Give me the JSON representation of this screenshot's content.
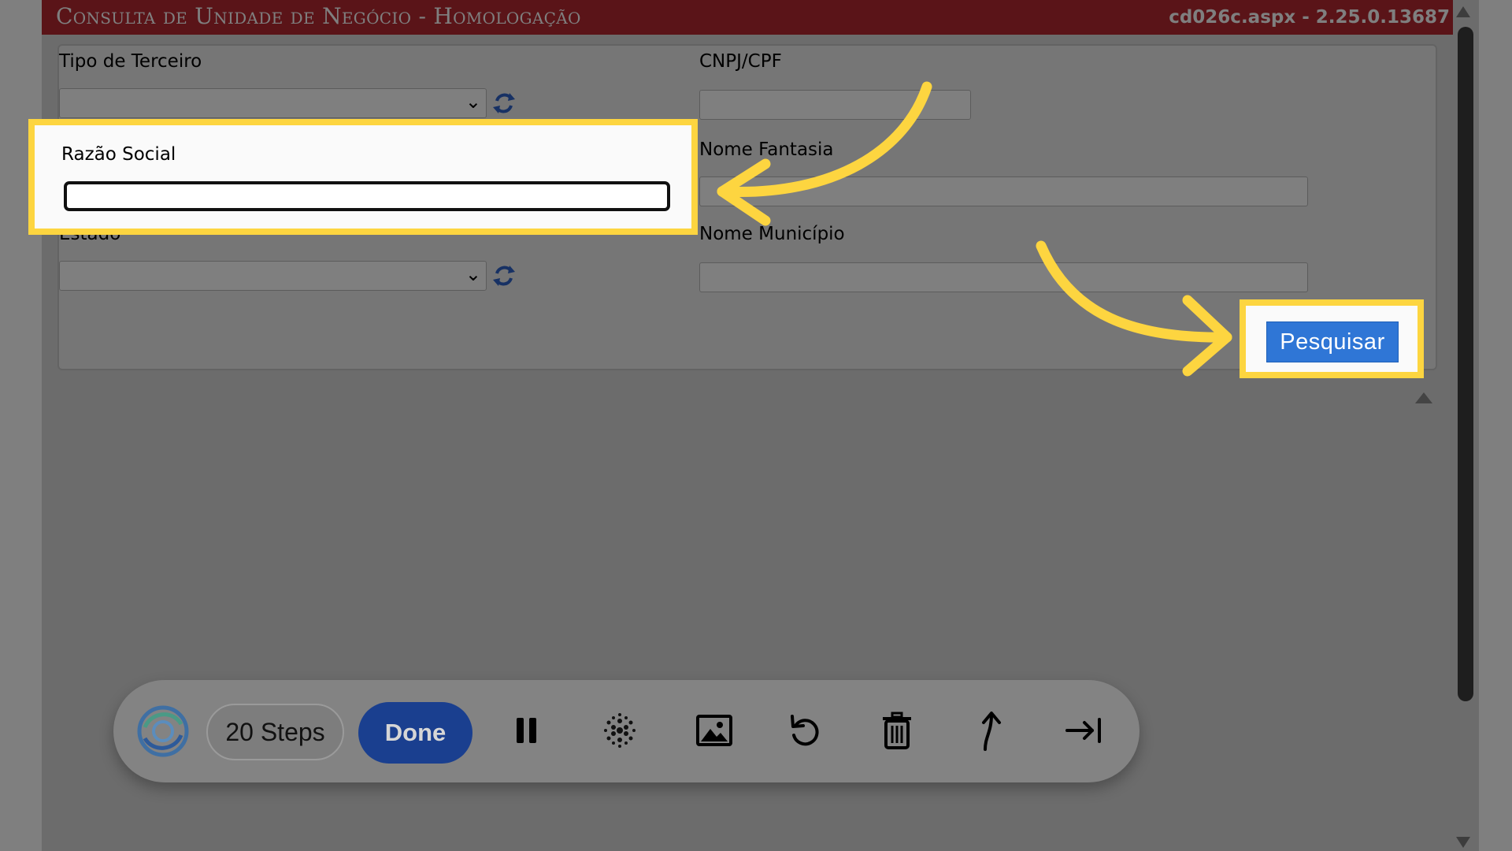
{
  "window": {
    "title": "Consulta de Unidade de Negócio  - Homologação",
    "version": "cd026c.aspx - 2.25.0.13687"
  },
  "form": {
    "tipo_terceiro": {
      "label": "Tipo de Terceiro",
      "value": ""
    },
    "cnpj_cpf": {
      "label": "CNPJ/CPF",
      "value": ""
    },
    "razao_social": {
      "label": "Razão Social",
      "value": ""
    },
    "nome_fantasia": {
      "label": "Nome Fantasia",
      "value": ""
    },
    "estado": {
      "label": "Estado",
      "value": ""
    },
    "nome_municipio": {
      "label": "Nome Município",
      "value": ""
    },
    "search_button": "Pesquisar"
  },
  "toolbar": {
    "steps_label": "20 Steps",
    "done_label": "Done",
    "icons": [
      "logo-icon",
      "pause-icon",
      "blur-icon",
      "image-icon",
      "undo-icon",
      "delete-icon",
      "upload-icon",
      "skip-icon"
    ]
  },
  "colors": {
    "titlebar": "#b52830",
    "highlight": "#fdd540",
    "search_button": "#2f76d6",
    "done_button": "#1a3f8f"
  }
}
